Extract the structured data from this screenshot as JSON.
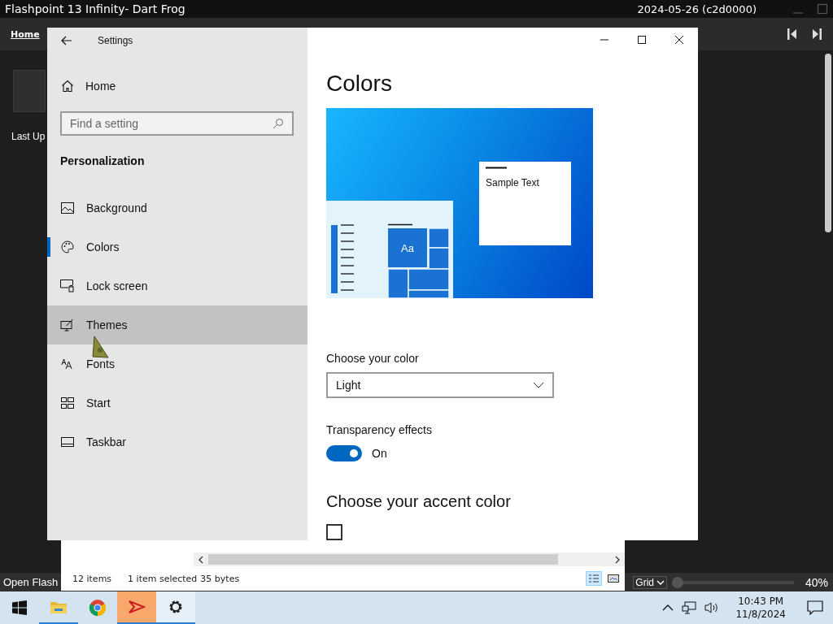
{
  "flashpoint": {
    "title": "Flashpoint 13 Infinity- Dart Frog",
    "version": "2024-05-26 (c2d0000)",
    "nav_link": "Home",
    "content_text": "Last Up",
    "status_text": "Open Flash",
    "view_mode": "Grid",
    "zoom": {
      "level": 0,
      "reading": "40%"
    }
  },
  "explorer": {
    "item_count": "12 items",
    "selection": "1 item selected",
    "size": "35 bytes"
  },
  "settings": {
    "title": "Settings",
    "home": "Home",
    "search": {
      "placeholder": "Find a setting"
    },
    "section": "Personalization",
    "nav_items": [
      {
        "label": "Background",
        "kind": "background",
        "selected": false,
        "hovered": false
      },
      {
        "label": "Colors",
        "kind": "colors",
        "selected": true,
        "hovered": false
      },
      {
        "label": "Lock screen",
        "kind": "lock",
        "selected": false,
        "hovered": false
      },
      {
        "label": "Themes",
        "kind": "themes",
        "selected": false,
        "hovered": true
      },
      {
        "label": "Fonts",
        "kind": "fonts",
        "selected": false,
        "hovered": false
      },
      {
        "label": "Start",
        "kind": "start",
        "selected": false,
        "hovered": false
      },
      {
        "label": "Taskbar",
        "kind": "taskbar",
        "selected": false,
        "hovered": false
      }
    ],
    "page_title": "Colors",
    "preview": {
      "sample_text": "Sample Text",
      "tile_text": "Aa"
    },
    "color_mode": {
      "label": "Choose your color",
      "value": "Light"
    },
    "transparency": {
      "label": "Transparency effects",
      "on": true,
      "state_text": "On"
    },
    "accent_heading": "Choose your accent color",
    "auto_pick": {
      "checked": false
    }
  },
  "taskbar": {
    "apps": [
      {
        "kind": "explorer",
        "running": true,
        "active": false,
        "attention": false
      },
      {
        "kind": "chrome",
        "running": false,
        "active": false,
        "attention": false
      },
      {
        "kind": "flashpoint",
        "running": true,
        "active": false,
        "attention": true
      },
      {
        "kind": "settings",
        "running": true,
        "active": true,
        "attention": false
      }
    ],
    "time": "10:43 PM",
    "date": "11/8/2024"
  }
}
